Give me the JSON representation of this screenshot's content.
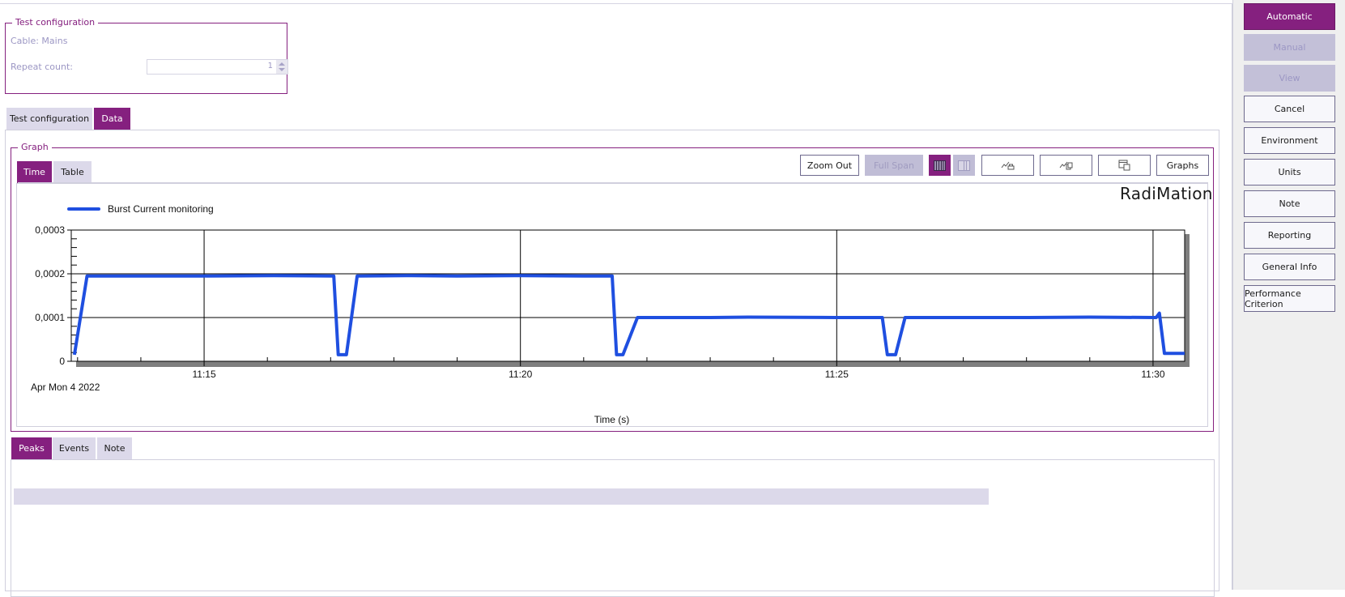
{
  "test_config": {
    "title": "Test configuration",
    "cable_label": "Cable: Mains",
    "repeat_count_label": "Repeat count:",
    "repeat_count_value": "1"
  },
  "main_tabs": [
    {
      "label": "Test configuration",
      "active": false
    },
    {
      "label": "Data",
      "active": true
    }
  ],
  "graph": {
    "title": "Graph",
    "tabs": [
      {
        "label": "Time",
        "active": true
      },
      {
        "label": "Table",
        "active": false
      }
    ],
    "toolbar": {
      "zoom_out": "Zoom Out",
      "full_span": "Full Span",
      "grid_toggle_icon": "vertical-grid-icon",
      "grid_toggle2_icon": "column-grid-icon",
      "print_graph_icon": "graph-print-icon",
      "copy_graph_icon": "graph-copy-icon",
      "copy_window_icon": "window-copy-icon",
      "graphs": "Graphs"
    },
    "logo": "RadiMation"
  },
  "chart_data": {
    "type": "line",
    "title": "",
    "xlabel": "Time (s)",
    "ylabel": "",
    "date_label": "Apr Mon 4 2022",
    "x_unit": "minutes since 11:00",
    "xlim": [
      12.9,
      30.5
    ],
    "ylim": [
      0,
      0.0003
    ],
    "y_ticks": [
      {
        "value": 0,
        "label": "0"
      },
      {
        "value": 0.0001,
        "label": "0,0001"
      },
      {
        "value": 0.0002,
        "label": "0,0002"
      },
      {
        "value": 0.0003,
        "label": "0,0003"
      }
    ],
    "x_ticks": [
      {
        "value": 15,
        "label": "11:15"
      },
      {
        "value": 20,
        "label": "11:20"
      },
      {
        "value": 25,
        "label": "11:25"
      },
      {
        "value": 30,
        "label": "11:30"
      }
    ],
    "x_minor_step": 1,
    "grid": true,
    "legend": {
      "position": "top-left"
    },
    "series": [
      {
        "name": "Burst Current monitoring",
        "color": "#1f4fe0",
        "points": [
          [
            12.95,
            1.5e-05
          ],
          [
            13.15,
            0.000195
          ],
          [
            15.0,
            0.000195
          ],
          [
            16.1,
            0.000196
          ],
          [
            17.05,
            0.000195
          ],
          [
            17.12,
            1.5e-05
          ],
          [
            17.25,
            1.5e-05
          ],
          [
            17.42,
            0.000195
          ],
          [
            18.2,
            0.000196
          ],
          [
            19.0,
            0.000195
          ],
          [
            20.0,
            0.000196
          ],
          [
            21.0,
            0.000195
          ],
          [
            21.45,
            0.000195
          ],
          [
            21.52,
            1.5e-05
          ],
          [
            21.62,
            1.5e-05
          ],
          [
            21.85,
            0.0001
          ],
          [
            23.0,
            0.0001
          ],
          [
            23.6,
            0.000101
          ],
          [
            25.0,
            0.0001
          ],
          [
            25.72,
            0.0001
          ],
          [
            25.8,
            1.5e-05
          ],
          [
            25.93,
            1.5e-05
          ],
          [
            26.08,
            0.0001
          ],
          [
            28.0,
            0.0001
          ],
          [
            29.0,
            0.000101
          ],
          [
            30.05,
            0.0001
          ],
          [
            30.1,
            0.00011
          ],
          [
            30.18,
            1.8e-05
          ],
          [
            30.5,
            1.8e-05
          ]
        ]
      }
    ]
  },
  "bottom_tabs": [
    {
      "label": "Peaks",
      "active": true
    },
    {
      "label": "Events",
      "active": false
    },
    {
      "label": "Note",
      "active": false
    }
  ],
  "side_buttons": [
    {
      "label": "Automatic",
      "state": "primary"
    },
    {
      "label": "Manual",
      "state": "disabled"
    },
    {
      "label": "View",
      "state": "disabled"
    },
    {
      "label": "Cancel",
      "state": "normal"
    },
    {
      "label": "Environment",
      "state": "normal"
    },
    {
      "label": "Units",
      "state": "normal"
    },
    {
      "label": "Note",
      "state": "normal"
    },
    {
      "label": "Reporting",
      "state": "normal"
    },
    {
      "label": "General Info",
      "state": "normal"
    },
    {
      "label": "Performance Criterion",
      "state": "normal"
    }
  ]
}
